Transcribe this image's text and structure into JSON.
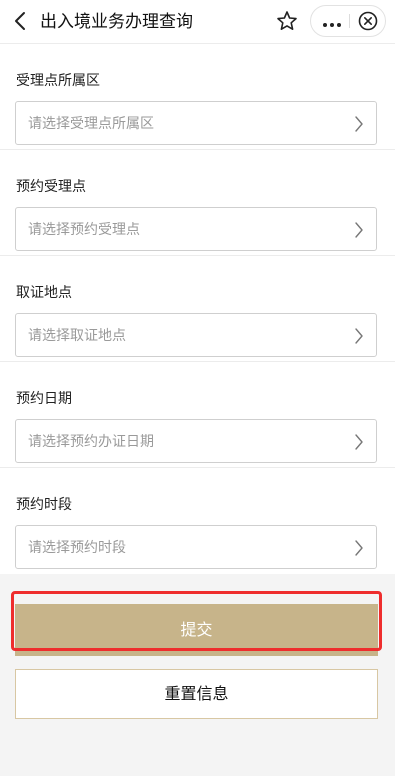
{
  "navbar": {
    "title": "出入境业务办理查询",
    "back_icon": "chevron-left-icon",
    "favorite_icon": "star-icon",
    "more_icon": "more-dots-icon",
    "close_icon": "close-circle-icon"
  },
  "form": {
    "fields": [
      {
        "label": "受理点所属区",
        "placeholder": "请选择受理点所属区"
      },
      {
        "label": "预约受理点",
        "placeholder": "请选择预约受理点"
      },
      {
        "label": "取证地点",
        "placeholder": "请选择取证地点"
      },
      {
        "label": "预约日期",
        "placeholder": "请选择预约办证日期"
      },
      {
        "label": "预约时段",
        "placeholder": "请选择预约时段"
      }
    ]
  },
  "actions": {
    "submit_label": "提交",
    "reset_label": "重置信息"
  },
  "colors": {
    "accent": "#c7b48a",
    "highlight_border": "#ee2d2d",
    "page_background": "#f4f4f4",
    "placeholder_text": "#9a9a9a"
  }
}
